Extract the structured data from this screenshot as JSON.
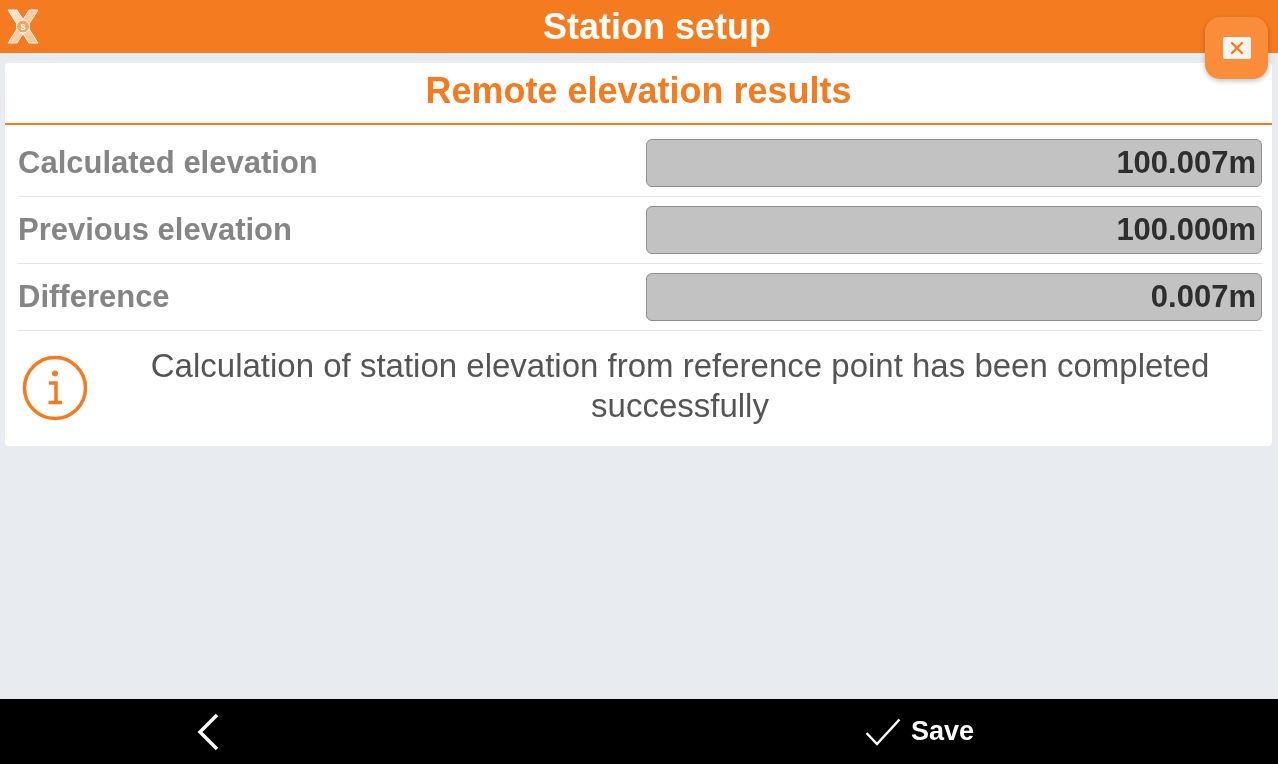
{
  "app_bar": {
    "logo_letter": "s",
    "title": "Station setup"
  },
  "panel": {
    "title": "Remote elevation results",
    "rows": [
      {
        "label": "Calculated elevation",
        "value": "100.007m"
      },
      {
        "label": "Previous elevation",
        "value": "100.000m"
      },
      {
        "label": "Difference",
        "value": "0.007m"
      }
    ],
    "message": "Calculation of station elevation from reference point has been completed successfully"
  },
  "bottom_bar": {
    "save_label": "Save"
  }
}
